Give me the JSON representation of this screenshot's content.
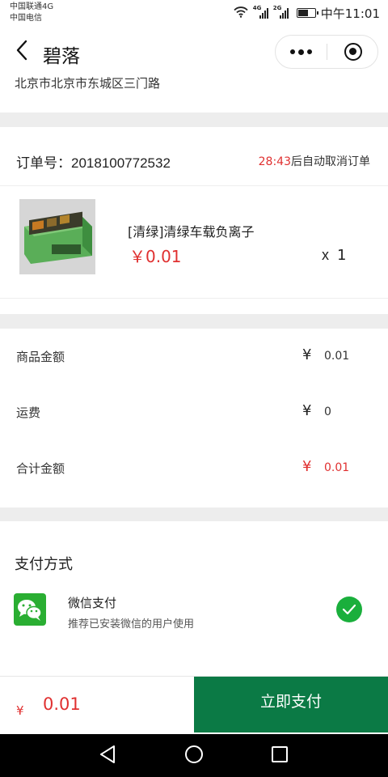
{
  "status_bar": {
    "carrier1": "中国联通4G",
    "carrier2": "中国电信",
    "signal1_tag": "4G",
    "signal2_tag": "2G",
    "time": "中午11:01"
  },
  "nav": {
    "title": "碧落"
  },
  "address": "北京市北京市东城区三门路",
  "order": {
    "number_label": "订单号：",
    "number": "2018100772532",
    "countdown_time": "28:43",
    "countdown_text": "后自动取消订单"
  },
  "product": {
    "title": "[清绿]清绿车载负离子",
    "price": "￥0.01",
    "qty_x": "x",
    "qty": "1"
  },
  "costs": {
    "goods_label": "商品金额",
    "goods_yen": "¥",
    "goods_value": "0.01",
    "shipping_label": "运费",
    "shipping_yen": "¥",
    "shipping_value": "0",
    "total_label": "合计金额",
    "total_yen": "¥",
    "total_value": "0.01"
  },
  "payment": {
    "heading": "支付方式",
    "method_name": "微信支付",
    "method_desc": "推荐已安装微信的用户使用"
  },
  "bottom": {
    "yen": "¥",
    "total": "0.01",
    "pay_label": "立即支付"
  },
  "colors": {
    "accent_red": "#e03030",
    "pay_button": "#0b7a45",
    "wechat_green": "#2aae32",
    "check_green": "#1aaf3c",
    "divider_gray": "#ededed"
  },
  "icons": {
    "back": "chevron-left-icon",
    "more": "more-dots-icon",
    "close": "target-close-icon",
    "wechat": "wechat-pay-icon",
    "selected": "check-circle-icon"
  }
}
